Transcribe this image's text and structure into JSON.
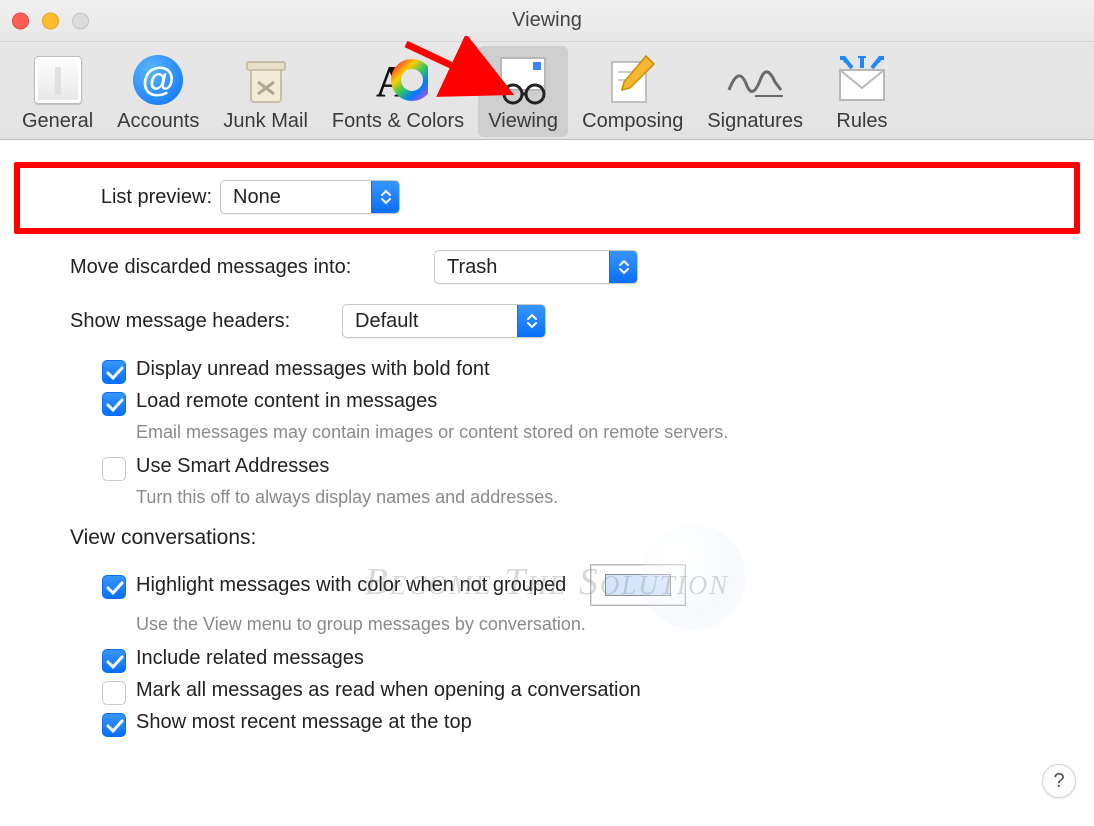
{
  "window": {
    "title": "Viewing"
  },
  "toolbar": {
    "tabs": [
      {
        "label": "General"
      },
      {
        "label": "Accounts"
      },
      {
        "label": "Junk Mail"
      },
      {
        "label": "Fonts & Colors"
      },
      {
        "label": "Viewing",
        "active": true
      },
      {
        "label": "Composing"
      },
      {
        "label": "Signatures"
      },
      {
        "label": "Rules"
      }
    ]
  },
  "settings": {
    "list_preview_label": "List preview:",
    "list_preview_value": "None",
    "move_discarded_label": "Move discarded messages into:",
    "move_discarded_value": "Trash",
    "show_headers_label": "Show message headers:",
    "show_headers_value": "Default",
    "bold_unread": {
      "label": "Display unread messages with bold font",
      "checked": true
    },
    "load_remote": {
      "label": "Load remote content in messages",
      "checked": true,
      "hint": "Email messages may contain images or content stored on remote servers."
    },
    "smart_addresses": {
      "label": "Use Smart Addresses",
      "checked": false,
      "hint": "Turn this off to always display names and addresses."
    },
    "view_conversations_label": "View conversations:",
    "highlight_color": {
      "label": "Highlight messages with color when not grouped",
      "checked": true,
      "hint": "Use the View menu to group messages by conversation.",
      "color": "#d5e5fb"
    },
    "include_related": {
      "label": "Include related messages",
      "checked": true
    },
    "mark_all_read": {
      "label": "Mark all messages as read when opening a conversation",
      "checked": false
    },
    "recent_top": {
      "label": "Show most recent message at the top",
      "checked": true
    }
  },
  "help_label": "?",
  "watermark": "Become The Solution"
}
